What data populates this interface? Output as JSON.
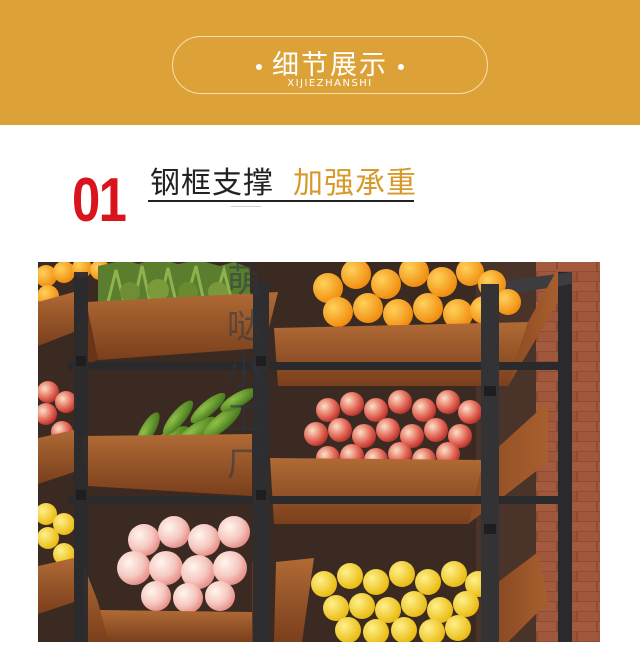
{
  "banner": {
    "title": "细节展示",
    "subtitle": "XIJIEZHANSHI",
    "background": "#dda237"
  },
  "section": {
    "number": "01",
    "heading_part1": "钢框支撑",
    "heading_part2": "加强承重",
    "number_color": "#d9141c",
    "accent_color": "#d69a2a"
  },
  "watermark": {
    "chars": [
      "萌",
      "哒",
      "小",
      "工",
      "厂"
    ]
  },
  "photo": {
    "description_icon": "fruit-vegetable-rack-photo"
  }
}
